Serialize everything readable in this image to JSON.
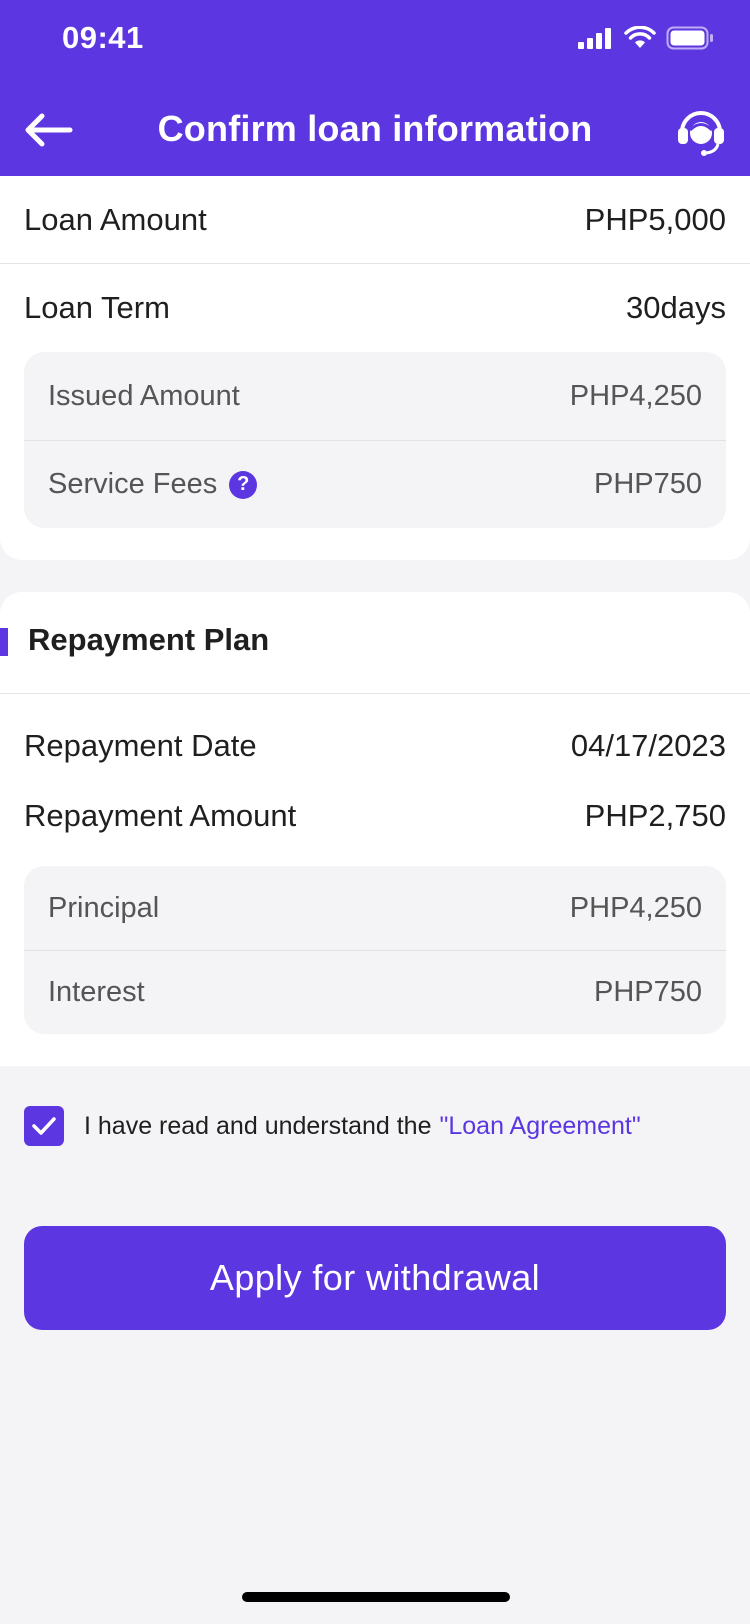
{
  "status_bar": {
    "time": "09:41"
  },
  "header": {
    "title": "Confirm loan information"
  },
  "loan": {
    "amount_label": "Loan Amount",
    "amount_value": "PHP5,000",
    "term_label": "Loan Term",
    "term_value": "30days",
    "details": [
      {
        "label": "Issued Amount",
        "value": "PHP4,250"
      },
      {
        "label": "Service Fees",
        "value": "PHP750"
      }
    ]
  },
  "repayment": {
    "section_title": "Repayment Plan",
    "date_label": "Repayment Date",
    "date_value": "04/17/2023",
    "amount_label": "Repayment Amount",
    "amount_value": "PHP2,750",
    "details": [
      {
        "label": "Principal",
        "value": "PHP4,250"
      },
      {
        "label": "Interest",
        "value": "PHP750"
      }
    ]
  },
  "agreement": {
    "checked": true,
    "text": "I have read and understand the",
    "link_text": "\"Loan Agreement\""
  },
  "actions": {
    "apply_label": "Apply for withdrawal"
  },
  "colors": {
    "accent": "#5c36e0",
    "background": "#f4f4f6",
    "card": "#ffffff"
  },
  "icons": [
    "back-arrow-icon",
    "support-agent-icon",
    "help-icon",
    "check-icon",
    "signal-icon",
    "wifi-icon",
    "battery-icon"
  ]
}
